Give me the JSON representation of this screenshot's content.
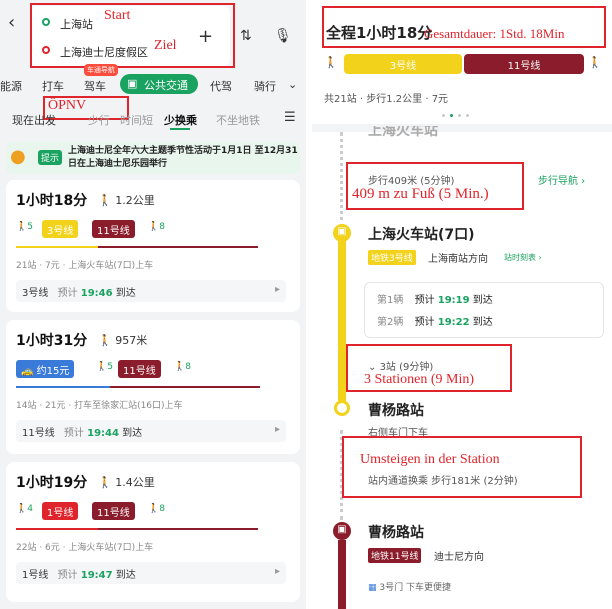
{
  "left": {
    "origin": "上海站",
    "destination": "上海迪士尼度假区",
    "anno_start": "Start",
    "anno_ziel": "Ziel",
    "anno_oepnv": "ÖPNV",
    "tabs": [
      "能源",
      "打车",
      "驾车",
      "公共交通",
      "代驾",
      "骑行"
    ],
    "tab_badge": "车通导航",
    "filters": [
      "现在出发",
      "少换乘",
      "不坐地铁"
    ],
    "filter_hidden": [
      "少行",
      "时间短"
    ],
    "notice_tag": "提示",
    "notice_text": "上海迪士尼全年六大主题季节性活动于1月1日 至12月31日在上海迪士尼乐园举行",
    "routes": [
      {
        "duration": "1小时18分",
        "walk": "1.2公里",
        "walk_a": "5",
        "lines": [
          "3号线",
          "11号线"
        ],
        "walk_b": "8",
        "info": "21站 · 7元 · 上海火车站(7口)上车",
        "arrive_line": "3号线",
        "arrive_pre": "预计",
        "arrive_time": "19:46",
        "arrive_post": "到达"
      },
      {
        "duration": "1小时31分",
        "walk": "957米",
        "taxi": "约15元",
        "walk_a": "5",
        "lines": [
          "11号线"
        ],
        "walk_b": "8",
        "info": "14站 · 21元 · 打车至徐家汇站(16口)上车",
        "arrive_line": "11号线",
        "arrive_pre": "预计",
        "arrive_time": "19:44",
        "arrive_post": "到达"
      },
      {
        "duration": "1小时19分",
        "walk": "1.4公里",
        "walk_a": "4",
        "lines": [
          "1号线",
          "11号线"
        ],
        "walk_b": "8",
        "info": "22站 · 6元 · 上海火车站(7口)上车",
        "arrive_line": "1号线",
        "arrive_pre": "预计",
        "arrive_time": "19:47",
        "arrive_post": "到达"
      }
    ],
    "colors": {
      "line1": "#e0242b",
      "line3": "#f2d21b",
      "line11": "#8a1c2b",
      "green": "#1aa260"
    }
  },
  "right": {
    "total": "全程1小时18分",
    "anno_total": "Gesamtdauer: 1Std. 18Min",
    "seg_line3": "3号线",
    "seg_line11": "11号线",
    "summary": "共21站 · 步行1.2公里 · 7元",
    "partial_station": "上海火车站",
    "walk_text": "步行409米 (5分钟)",
    "anno_walk": "409 m zu Fuß (5 Min.)",
    "walk_nav": "步行导航",
    "station1": "上海火车站(7口)",
    "line_tag": "地铁3号线",
    "direction": "上海南站方向",
    "timetable": "站时刻表",
    "trains": [
      {
        "label": "第1辆",
        "pre": "预计",
        "time": "19:19",
        "post": "到达"
      },
      {
        "label": "第2辆",
        "pre": "预计",
        "time": "19:22",
        "post": "到达"
      }
    ],
    "stops": "3站 (9分钟)",
    "anno_stops": "3 Stationen (9 Min)",
    "station2": "曹杨路站",
    "exit_hint": "右侧车门下车",
    "anno_transfer": "Umsteigen in der Station",
    "transfer_text": "站内通道换乘 步行181米 (2分钟)",
    "station3": "曹杨路站",
    "line_tag2": "地铁11号线",
    "direction2": "迪士尼方向",
    "door_hint": "3号门 下车更便捷"
  }
}
